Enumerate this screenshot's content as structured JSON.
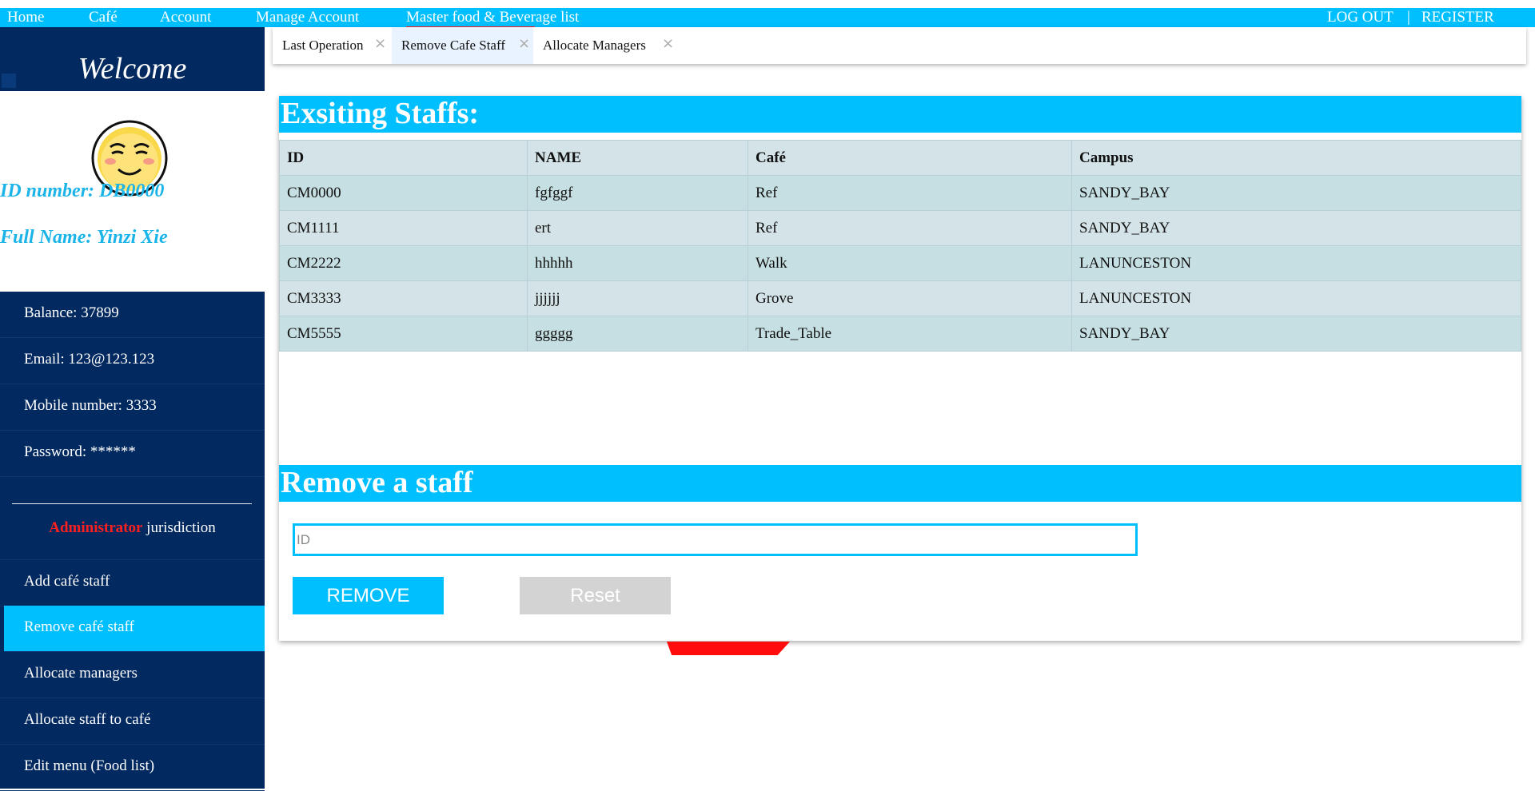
{
  "nav": {
    "items": [
      "Home",
      "Café",
      "Account",
      "Manage Account",
      "Master food & Beverage list"
    ],
    "logout": "LOG OUT",
    "separator": "|",
    "register": "REGISTER"
  },
  "sidebar": {
    "welcome": "Welcome",
    "id_number": "ID number: DB0000",
    "full_name": "Full Name: Yinzi Xie",
    "info": [
      "Balance: 37899",
      "Email: 123@123.123",
      "Mobile number: 3333",
      "Password: ******"
    ],
    "jurisdiction_role": "Administrator",
    "jurisdiction_suffix": " jurisdiction",
    "menu": [
      "Add café staff",
      "Remove café staff",
      "Allocate managers",
      "Allocate staff to café",
      "Edit menu (Food list)"
    ],
    "active_menu": "Remove café staff"
  },
  "tabs": [
    {
      "label": "Last Operation"
    },
    {
      "label": "Remove Cafe Staff"
    },
    {
      "label": "Allocate Managers"
    }
  ],
  "active_tab": "Remove Cafe Staff",
  "existing": {
    "title": "Exsiting Staffs:",
    "columns": [
      "ID",
      "NAME",
      "Café",
      "Campus"
    ],
    "rows": [
      [
        "CM0000",
        "fgfggf",
        "Ref",
        "SANDY_BAY"
      ],
      [
        "CM1111",
        "ert",
        "Ref",
        "SANDY_BAY"
      ],
      [
        "CM2222",
        "hhhhh",
        "Walk",
        "LANUNCESTON"
      ],
      [
        "CM3333",
        "jjjjjj",
        "Grove",
        "LANUNCESTON"
      ],
      [
        "CM5555",
        "ggggg",
        "Trade_Table",
        "SANDY_BAY"
      ]
    ]
  },
  "remove": {
    "title": "Remove a staff",
    "id_placeholder": "ID",
    "id_value": "",
    "remove_label": "REMOVE",
    "reset_label": "Reset"
  },
  "colors": {
    "accent": "#00bfff",
    "sidebar": "#032a60",
    "highlight": "#ff1f1f"
  }
}
